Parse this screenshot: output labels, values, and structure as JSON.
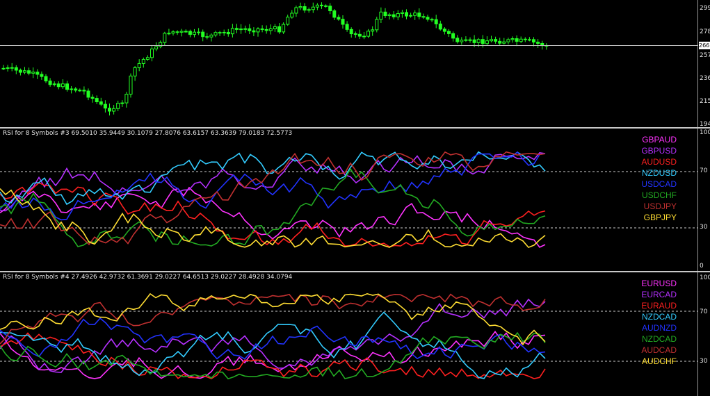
{
  "main_chart": {
    "price_scale": [
      "299",
      "278",
      "257",
      "236",
      "215",
      "194"
    ],
    "current_price": "266",
    "candle_color": "#22ff22"
  },
  "pane1": {
    "title": "RSI for 8 Symbols #3 69.5010 35.9449 30.1079 27.8076 63.6157 63.3639 79.0183 72.5773",
    "scale": [
      "100",
      "70",
      "30",
      "0"
    ],
    "symbols": [
      {
        "name": "GBPAUD",
        "color": "#ff33ff"
      },
      {
        "name": "GBPUSD",
        "color": "#b530ff"
      },
      {
        "name": "AUDUSD",
        "color": "#ff2020"
      },
      {
        "name": "NZDUSD",
        "color": "#33ccff"
      },
      {
        "name": "USDCAD",
        "color": "#2233ff"
      },
      {
        "name": "USDCHF",
        "color": "#22aa22"
      },
      {
        "name": "USDJPY",
        "color": "#c03030"
      },
      {
        "name": "GBPJPY",
        "color": "#ffdd33"
      }
    ]
  },
  "pane2": {
    "title": "RSI for 8 Symbols #4 27.4926 42.9732 61.3691 29.0227 64.6513 29.0227 28.4928 34.0794",
    "scale": [
      "100",
      "70",
      "30"
    ],
    "symbols": [
      {
        "name": "EURUSD",
        "color": "#ff33ff"
      },
      {
        "name": "EURCAD",
        "color": "#b530ff"
      },
      {
        "name": "EURAUD",
        "color": "#ff2020"
      },
      {
        "name": "NZDCAD",
        "color": "#33ccff"
      },
      {
        "name": "AUDNZD",
        "color": "#2233ff"
      },
      {
        "name": "NZDCAD",
        "color": "#22aa22"
      },
      {
        "name": "AUDCAD",
        "color": "#c03030"
      },
      {
        "name": "AUDCHF",
        "color": "#ffdd33"
      }
    ]
  }
}
